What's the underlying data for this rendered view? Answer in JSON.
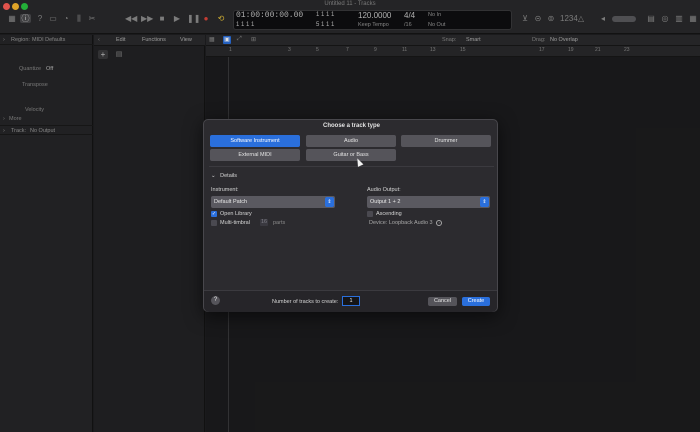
{
  "window": {
    "title": "Untitled 11 - Tracks"
  },
  "lcd": {
    "time": "01:00:00:00.00",
    "bars_top": "1  1  1  1",
    "bars_bottom": "1  1  1  1",
    "beats_bottom": "5  1  1  1",
    "tempo": "120.0000",
    "tempo_mode": "Keep Tempo",
    "signature": "4/4",
    "division": "/16",
    "midi_in": "No In",
    "midi_out": "No Out"
  },
  "inspector": {
    "region_label": "Region:",
    "region_value": "MIDI Defaults",
    "quantize_label": "Quantize",
    "quantize_value": "Off",
    "transpose_label": "Transpose",
    "velocity_label": "Velocity",
    "more_label": "More",
    "track_label": "Track:",
    "track_value": "No Output"
  },
  "tracks_menu": {
    "edit": "Edit",
    "functions": "Functions",
    "view": "View"
  },
  "arrange_toolbar": {
    "snap_label": "Snap:",
    "snap_value": "Smart",
    "drag_label": "Drag:",
    "drag_value": "No Overlap"
  },
  "ruler": {
    "bars": [
      "1",
      "3",
      "5",
      "7",
      "9",
      "11",
      "13",
      "15",
      "17",
      "19",
      "21",
      "23"
    ]
  },
  "dialog": {
    "title": "Choose a track type",
    "types": [
      {
        "label": "Software Instrument",
        "selected": true
      },
      {
        "label": "Audio",
        "selected": false
      },
      {
        "label": "Drummer",
        "selected": false
      },
      {
        "label": "External MIDI",
        "selected": false
      },
      {
        "label": "Guitar or Bass",
        "selected": false
      }
    ],
    "details_label": "Details",
    "instrument_label": "Instrument:",
    "instrument_value": "Default Patch",
    "open_library_label": "Open Library",
    "open_library_checked": true,
    "multitimbral_label": "Multi-timbral",
    "multitimbral_count": "16",
    "parts_label": "parts",
    "audio_output_label": "Audio Output:",
    "audio_output_value": "Output 1 + 2",
    "ascending_label": "Ascending",
    "ascending_checked": false,
    "device_label": "Device: Loopback Audio 3",
    "num_tracks_label": "Number of tracks to create:",
    "num_tracks_value": "1",
    "help_label": "?",
    "cancel_label": "Cancel",
    "create_label": "Create"
  },
  "colors": {
    "accent": "#2a6fdc",
    "dialog_bg": "#2c2b2f",
    "button": "#55545a"
  }
}
